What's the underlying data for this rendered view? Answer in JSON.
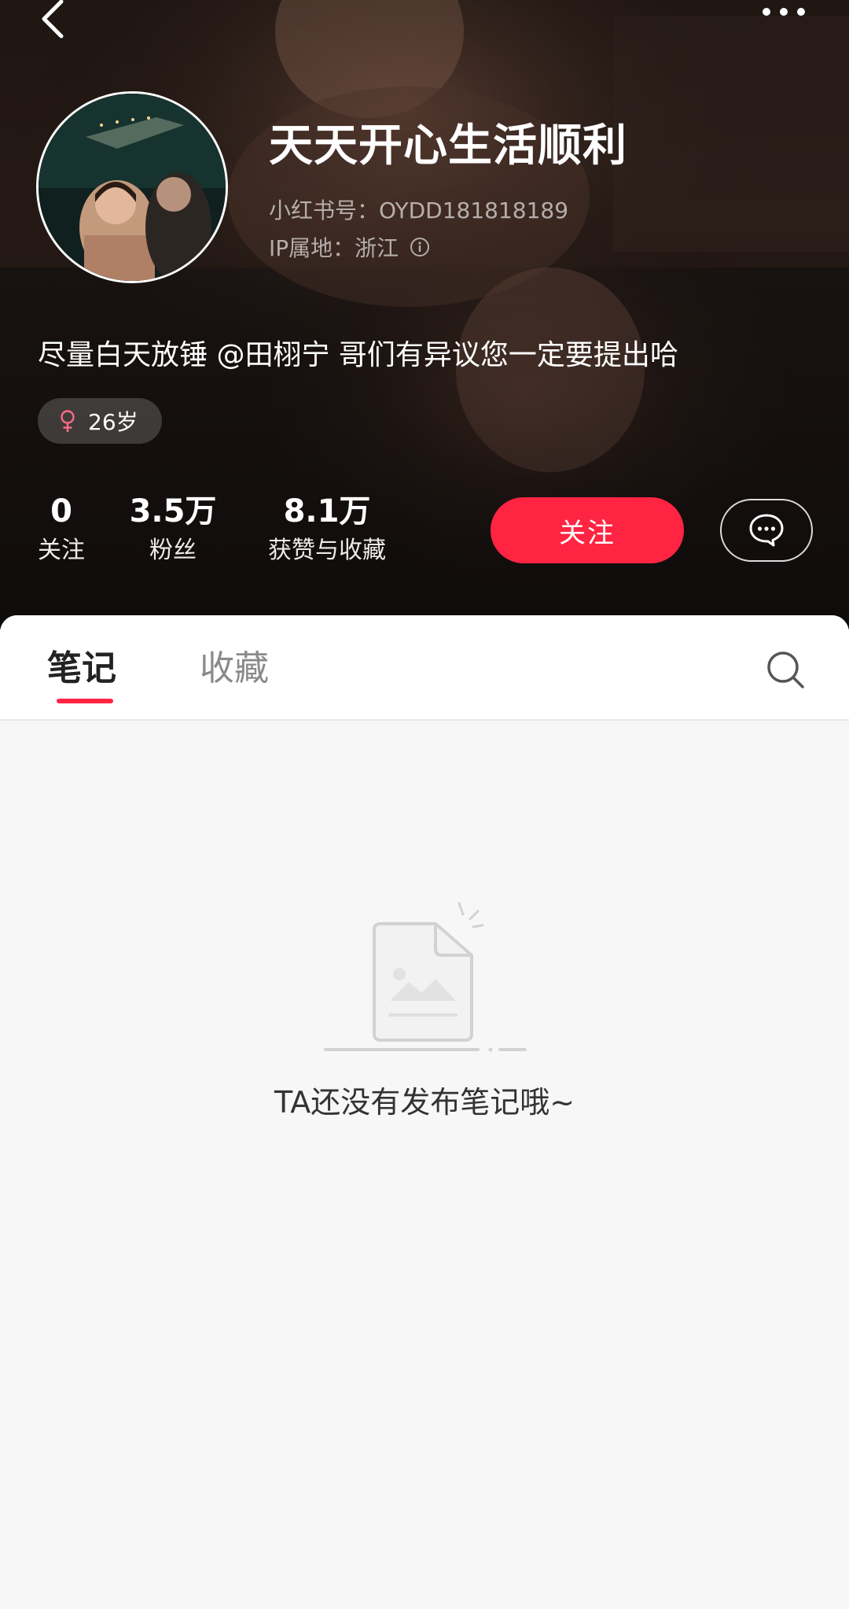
{
  "profile": {
    "username": "天天开心生活顺利",
    "account_id": "小红书号：OYDD181818189",
    "ip_location": "IP属地：浙江",
    "bio": "尽量白天放锤 @田栩宁 哥们有异议您一定要提出哈",
    "tags": [
      {
        "label": "26岁",
        "icon": "female-icon"
      }
    ]
  },
  "stats": [
    {
      "value": "0",
      "label": "关注"
    },
    {
      "value": "3.5万",
      "label": "粉丝"
    },
    {
      "value": "8.1万",
      "label": "获赞与收藏"
    }
  ],
  "actions": {
    "follow_label": "关注",
    "chat_icon": "chat-bubble-icon"
  },
  "tabs": [
    {
      "label": "笔记",
      "active": true
    },
    {
      "label": "收藏",
      "active": false
    }
  ],
  "empty_state": {
    "message": "TA还没有发布笔记哦~"
  },
  "colors": {
    "accent": "#ff2442",
    "header_bg": "#1a1311",
    "content_bg": "#f7f7f7"
  },
  "icons": [
    "back-icon",
    "more-icon",
    "info-icon",
    "female-icon",
    "chat-bubble-icon",
    "search-icon",
    "empty-document-icon"
  ]
}
